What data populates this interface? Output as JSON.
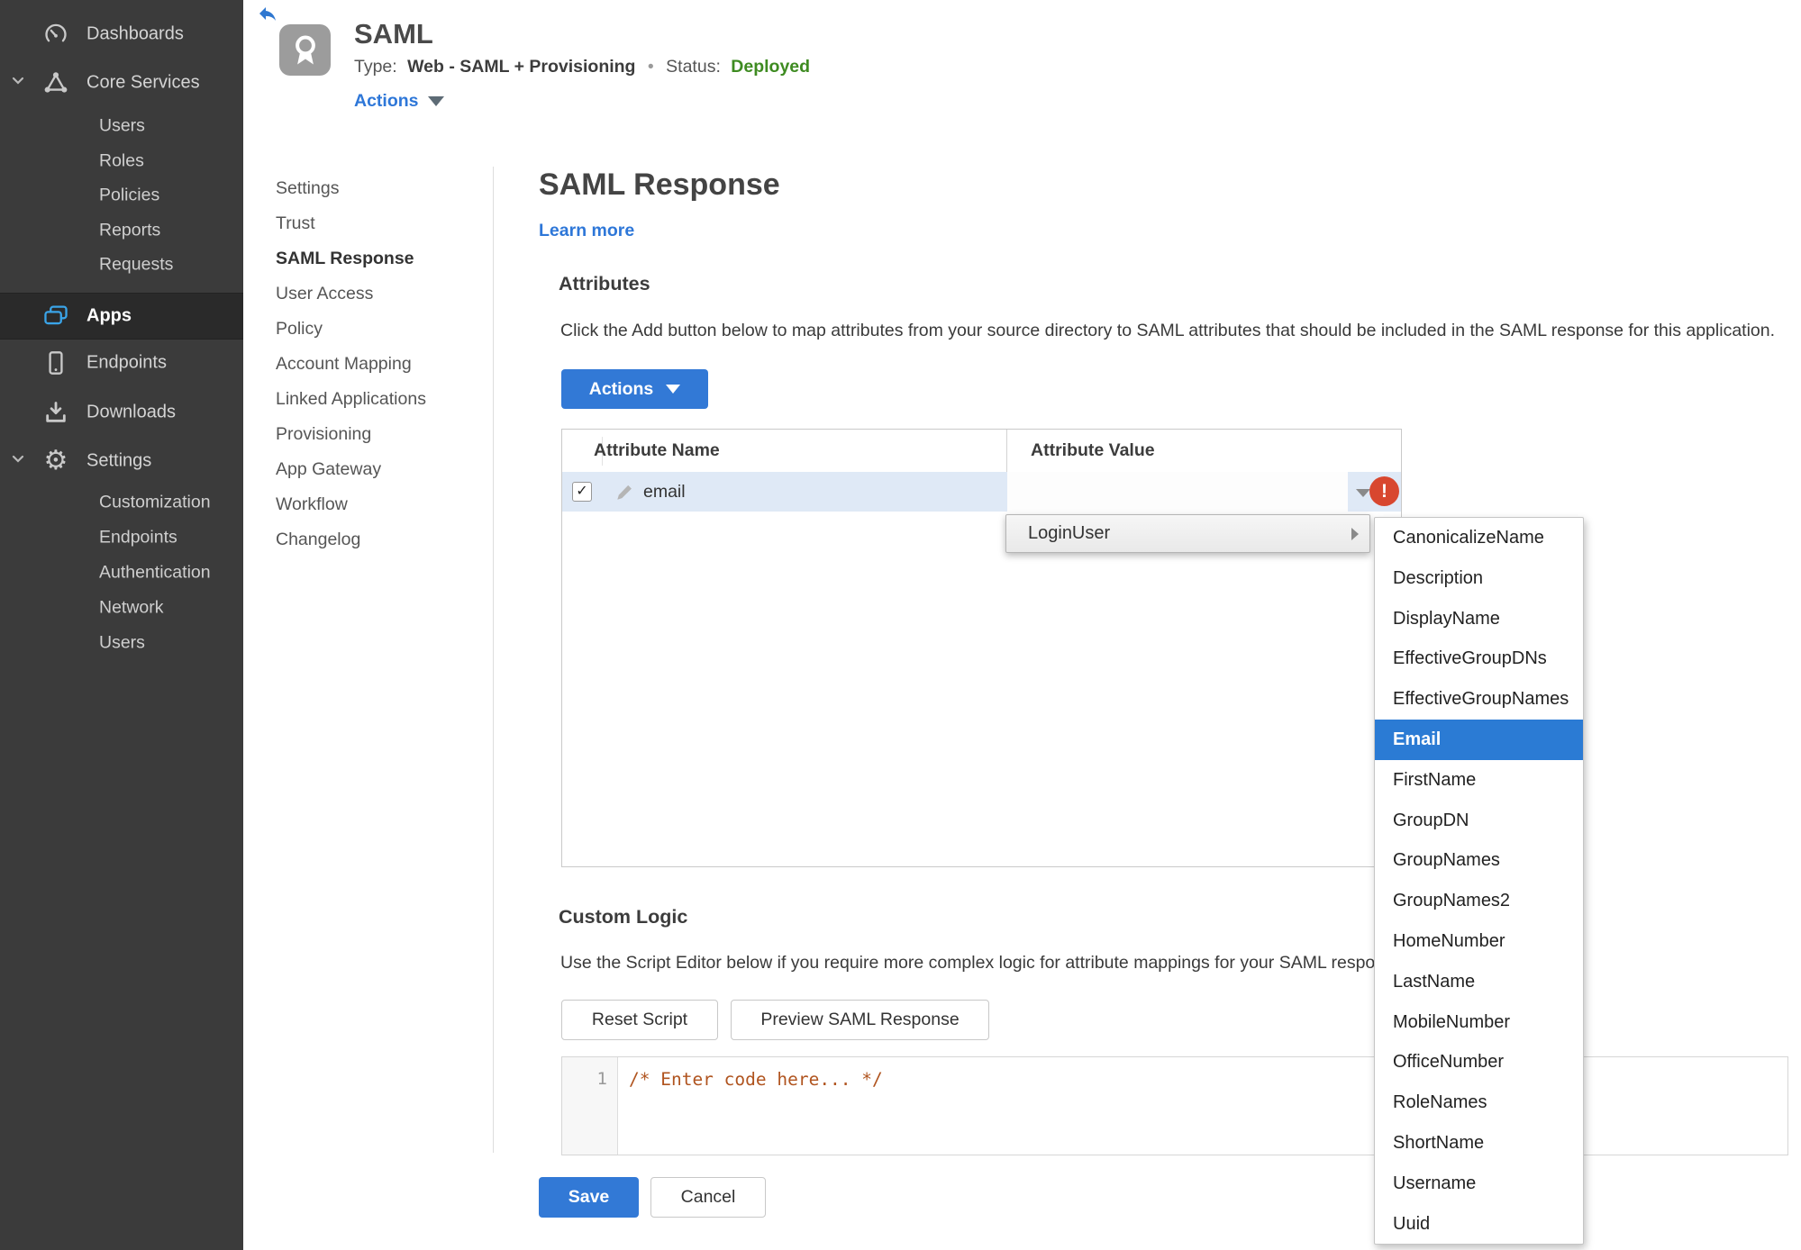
{
  "colors": {
    "accent_blue": "#2e77d8",
    "button_blue": "#3279d6",
    "menu_highlight_blue": "#2b7bd4",
    "status_green": "#3e8b21",
    "error_red": "#d8472f",
    "sidebar_bg": "#3b3b3b",
    "sidebar_active_bg": "#2a2a2a",
    "row_highlight": "#dfe9f6",
    "code_comment": "#b0541f"
  },
  "icons": {
    "checkmark": "✓",
    "error_exclamation": "!",
    "gear": "⚙"
  },
  "sidebar": {
    "dashboards": "Dashboards",
    "core_services": "Core Services",
    "core_children": [
      "Users",
      "Roles",
      "Policies",
      "Reports",
      "Requests"
    ],
    "apps": "Apps",
    "endpoints": "Endpoints",
    "downloads": "Downloads",
    "settings": "Settings",
    "settings_children": [
      "Customization",
      "Endpoints",
      "Authentication",
      "Network",
      "Users"
    ]
  },
  "header": {
    "title": "SAML",
    "type_label": "Type:",
    "type_value": "Web - SAML + Provisioning",
    "bullet": "•",
    "status_label": "Status:",
    "status_value": "Deployed",
    "actions_label": "Actions"
  },
  "nav": {
    "items": [
      "Settings",
      "Trust",
      "SAML Response",
      "User Access",
      "Policy",
      "Account Mapping",
      "Linked Applications",
      "Provisioning",
      "App Gateway",
      "Workflow",
      "Changelog"
    ],
    "active": "SAML Response"
  },
  "main": {
    "title": "SAML Response",
    "learn_more": "Learn more",
    "attributes": {
      "heading": "Attributes",
      "description": "Click the Add button below to map attributes from your source directory to SAML attributes that should be included in the SAML response for this application.",
      "actions_button": "Actions",
      "table": {
        "columns": [
          "Attribute Name",
          "Attribute Value"
        ],
        "row": {
          "name": "email",
          "value": "",
          "checked": true,
          "error": true
        }
      }
    },
    "dropdown": {
      "parent_item": "LoginUser",
      "options": [
        "CanonicalizeName",
        "Description",
        "DisplayName",
        "EffectiveGroupDNs",
        "EffectiveGroupNames",
        "Email",
        "FirstName",
        "GroupDN",
        "GroupNames",
        "GroupNames2",
        "HomeNumber",
        "LastName",
        "MobileNumber",
        "OfficeNumber",
        "RoleNames",
        "ShortName",
        "Username",
        "Uuid"
      ],
      "highlighted": "Email"
    },
    "custom_logic": {
      "heading": "Custom Logic",
      "description": "Use the Script Editor below if you require more complex logic for attribute mappings for your SAML response.",
      "reset_button": "Reset Script",
      "preview_button": "Preview SAML Response",
      "editor": {
        "line_number": "1",
        "code": "/* Enter code here... */"
      }
    },
    "footer": {
      "save": "Save",
      "cancel": "Cancel"
    }
  }
}
